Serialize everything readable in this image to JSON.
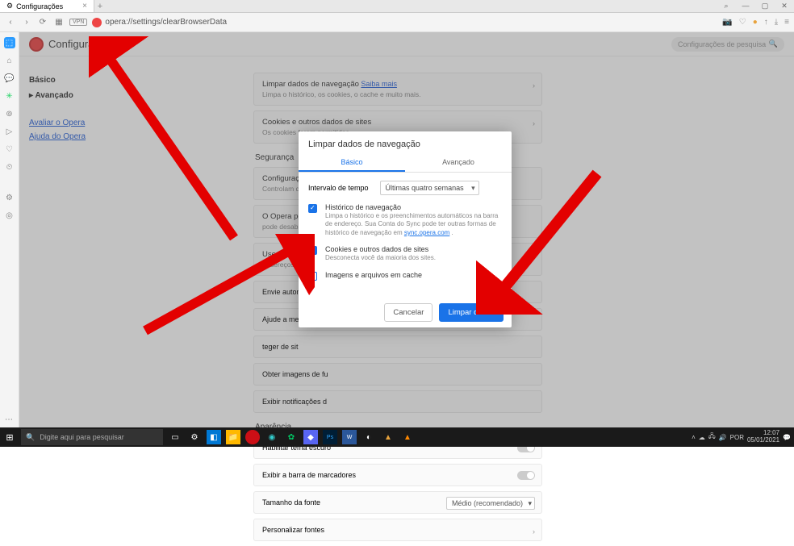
{
  "tab": {
    "title": "Configurações"
  },
  "windowControls": {
    "search": "⌕",
    "min": "—",
    "max": "▢",
    "close": "✕"
  },
  "toolbar": {
    "back": "‹",
    "fwd": "›",
    "reload": "⟳",
    "grid": "▦",
    "vpn": "VPN",
    "url": "opera://settings/clearBrowserData",
    "icons": {
      "camera": "📷",
      "heart": "♡",
      "dot": "●",
      "up": "↑",
      "down": "⤓",
      "menu": "≡"
    }
  },
  "sidebarLeft": [
    "⬚",
    "⌂",
    "💬",
    "✳",
    "—",
    "⊚",
    "▷",
    "—",
    "♡",
    "⏲",
    "—",
    "⚙",
    "◎"
  ],
  "page": {
    "title": "Configurações",
    "searchPlaceholder": "Configurações de pesquisa"
  },
  "nav": {
    "basico": "Básico",
    "avancado": "Avançado",
    "avaliar": "Avaliar o Opera",
    "ajuda": "Ajuda do Opera"
  },
  "sections": {
    "limpar": {
      "title": "Limpar dados de navegação",
      "link": "Saiba mais",
      "sub": "Limpa o histórico, os cookies, o cache e muito mais."
    },
    "cookies": {
      "title": "Cookies e outros dados de sites",
      "sub": "Os cookies foram permitidos"
    },
    "seguranca": "Segurança",
    "config": {
      "title": "Configurações do site",
      "sub": "Controlam quais inf"
    },
    "opera_usar": "O Opera pode usar",
    "desabilitar": "pode desabilitar is",
    "servico": "Use um serviço de",
    "enderecos": "endereços.",
    "envie": "Envie automaticamen",
    "ajude": "Ajude a melh",
    "teger": "teger de sit",
    "obter": "Obter imagens de fu",
    "exibir": "Exibir notificações d",
    "aparencia": "Aparência",
    "tema": "Habilitar tema escuro",
    "marcadores": "Exibir a barra de marcadores",
    "fonte": {
      "title": "Tamanho da fonte",
      "value": "Médio (recomendado)"
    },
    "personalizar": "Personalizar fontes"
  },
  "modal": {
    "title": "Limpar dados de navegação",
    "tabs": {
      "basico": "Básico",
      "avancado": "Avançado"
    },
    "timeLabel": "Intervalo de tempo",
    "timeValue": "Últimas quatro semanas",
    "opt1": {
      "t": "Histórico de navegação",
      "d1": "Limpa o histórico e os preenchimentos automáticos na barra de endereço.",
      "d2": "Sua Conta do Sync pode ter outras formas de histórico de navegação em",
      "link": "sync.opera.com"
    },
    "opt2": {
      "t": "Cookies e outros dados de sites",
      "d": "Desconecta você da maioria dos sites."
    },
    "opt3": {
      "t": "Imagens e arquivos em cache"
    },
    "cancel": "Cancelar",
    "clear": "Limpar dados"
  },
  "taskbar": {
    "searchPlaceholder": "Digite aqui para pesquisar",
    "time": "12:07",
    "date": "05/01/2021"
  }
}
